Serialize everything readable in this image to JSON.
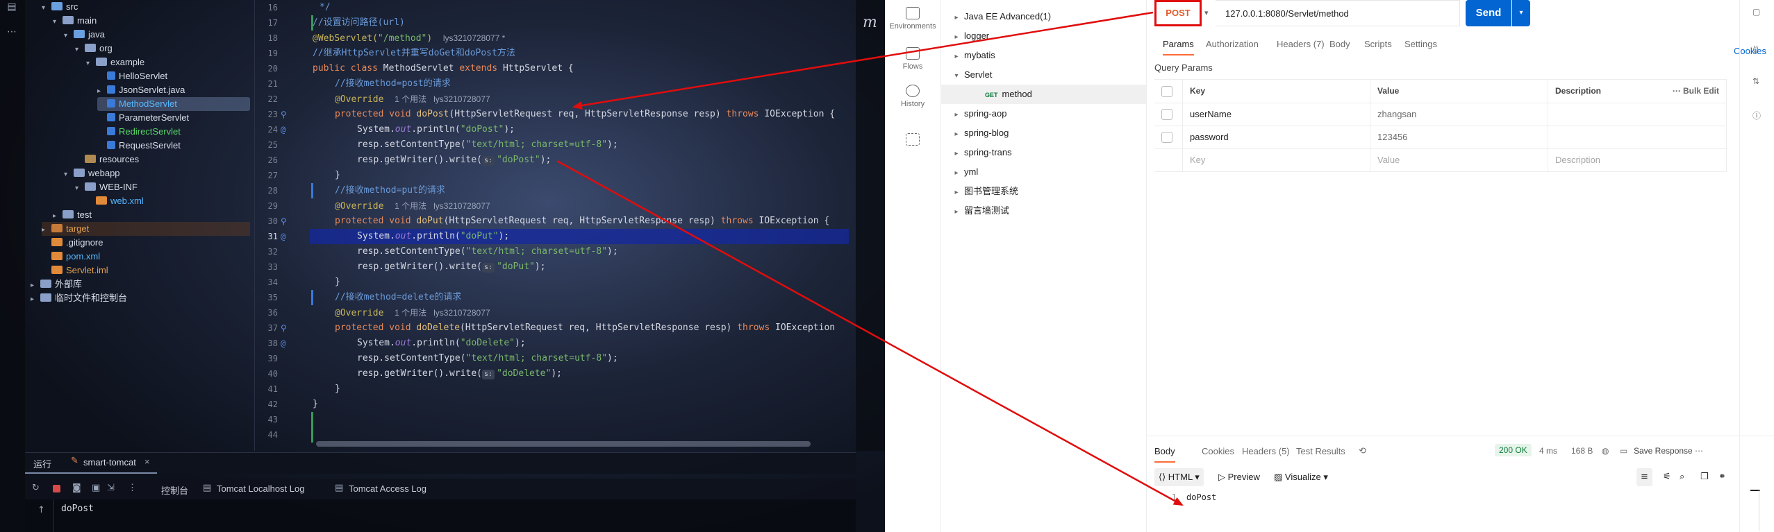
{
  "ide": {
    "tree": [
      {
        "label": "src",
        "indent": 1,
        "arrow": "v",
        "icon": "folder src"
      },
      {
        "label": "main",
        "indent": 2,
        "arrow": "v",
        "icon": "folder"
      },
      {
        "label": "java",
        "indent": 3,
        "arrow": "v",
        "icon": "folder src"
      },
      {
        "label": "org",
        "indent": 4,
        "arrow": "v",
        "icon": "folder"
      },
      {
        "label": "example",
        "indent": 5,
        "arrow": "v",
        "icon": "folder"
      },
      {
        "label": "HelloServlet",
        "indent": 6,
        "arrow": "",
        "icon": "cls"
      },
      {
        "label": "JsonServlet.java",
        "indent": 6,
        "arrow": ">",
        "icon": "cls"
      },
      {
        "label": "MethodServlet",
        "indent": 6,
        "arrow": "",
        "icon": "cls",
        "selected": true,
        "color": "#58b8ff"
      },
      {
        "label": "ParameterServlet",
        "indent": 6,
        "arrow": "",
        "icon": "cls"
      },
      {
        "label": "RedirectServlet",
        "indent": 6,
        "arrow": "",
        "icon": "cls",
        "color": "#5ad86a"
      },
      {
        "label": "RequestServlet",
        "indent": 6,
        "arrow": "",
        "icon": "cls"
      },
      {
        "label": "resources",
        "indent": 4,
        "arrow": "",
        "icon": "folder res"
      },
      {
        "label": "webapp",
        "indent": 3,
        "arrow": "v",
        "icon": "folder"
      },
      {
        "label": "WEB-INF",
        "indent": 4,
        "arrow": "v",
        "icon": "folder"
      },
      {
        "label": "web.xml",
        "indent": 5,
        "arrow": "",
        "icon": "xml",
        "color": "#58b8ff"
      },
      {
        "label": "test",
        "indent": 2,
        "arrow": ">",
        "icon": "folder"
      },
      {
        "label": "target",
        "indent": 1,
        "arrow": ">",
        "icon": "folder target",
        "target": true,
        "color": "#e0a050"
      },
      {
        "label": ".gitignore",
        "indent": 1,
        "arrow": "",
        "icon": "xml"
      },
      {
        "label": "pom.xml",
        "indent": 1,
        "arrow": "",
        "icon": "xml",
        "color": "#58b8ff"
      },
      {
        "label": "Servlet.iml",
        "indent": 1,
        "arrow": "",
        "icon": "xml",
        "color": "#e0a050"
      },
      {
        "label": "外部库",
        "indent": 0,
        "arrow": ">",
        "icon": "folder"
      },
      {
        "label": "临时文件和控制台",
        "indent": 0,
        "arrow": ">",
        "icon": "folder"
      }
    ],
    "line_numbers": [
      "16",
      "17",
      "18",
      "19",
      "20",
      "21",
      "22",
      "23",
      "24",
      "25",
      "26",
      "27",
      "28",
      "29",
      "30",
      "31",
      "32",
      "33",
      "34",
      "35",
      "36",
      "37",
      "38",
      "39",
      "40",
      "41",
      "42",
      "43",
      "44"
    ],
    "code": {
      "l16": "*/",
      "l17": "//设置访问路径(url)",
      "l18a": "@WebServlet(",
      "l18b": "\"/method\"",
      "l18c": ")",
      "l18hint": "lys3210728077 *",
      "l19": "//继承HttpServlet并重写doGet和doPost方法",
      "l20a": "public class ",
      "l20b": "MethodServlet ",
      "l20c": "extends ",
      "l20d": "HttpServlet {",
      "l21": "//接收method=post的请求",
      "l22a": "@Override",
      "l22hint": "1 个用法   lys3210728077",
      "l23a": "protected void ",
      "l23b": "doPost",
      "l23c": "(HttpServletRequest req, HttpServletResponse resp) ",
      "l23d": "throws ",
      "l23e": "IOException {",
      "l24a": "System.",
      "l24b": "out",
      "l24c": ".println(",
      "l24d": "\"doPost\"",
      "l24e": ");",
      "l25a": "resp.setContentType(",
      "l25b": "\"text/html; charset=utf-8\"",
      "l25c": ");",
      "l26a": "resp.getWriter().write(",
      "l26pill": "s:",
      "l26b": "\"doPost\"",
      "l26c": ");",
      "l27": "}",
      "l28": "//接收method=put的请求",
      "l29a": "@Override",
      "l29hint": "1 个用法   lys3210728077",
      "l30a": "protected void ",
      "l30b": "doPut",
      "l30c": "(HttpServletRequest req, HttpServletResponse resp) ",
      "l30d": "throws ",
      "l30e": "IOException {",
      "l31a": "System.",
      "l31b": "out",
      "l31c": ".println(",
      "l31d": "\"doPut\"",
      "l31e": ");",
      "l32a": "resp.setContentType(",
      "l32b": "\"text/html; charset=utf-8\"",
      "l32c": ");",
      "l33a": "resp.getWriter().write(",
      "l33pill": "s:",
      "l33b": "\"doPut\"",
      "l33c": ");",
      "l34": "}",
      "l35": "//接收method=delete的请求",
      "l36a": "@Override",
      "l36hint": "1 个用法   lys3210728077",
      "l37a": "protected void ",
      "l37b": "doDelete",
      "l37c": "(HttpServletRequest req, HttpServletResponse resp) ",
      "l37d": "throws ",
      "l37e": "IOException",
      "l38a": "System.",
      "l38b": "out",
      "l38c": ".println(",
      "l38d": "\"doDelete\"",
      "l38e": ");",
      "l39a": "resp.setContentType(",
      "l39b": "\"text/html; charset=utf-8\"",
      "l39c": ");",
      "l40a": "resp.getWriter().write(",
      "l40pill": "s:",
      "l40b": "\"doDelete\"",
      "l40c": ");",
      "l41": "}",
      "l42": "}"
    },
    "run": {
      "title": "运行",
      "config": "smart-tomcat",
      "close": "×",
      "tabs": [
        "控制台",
        "Tomcat Localhost Log",
        "Tomcat Access Log"
      ],
      "output": "doPost",
      "up_arrow": "↑"
    },
    "logo": "m"
  },
  "postman": {
    "rail": [
      "Environments",
      "Flows",
      "History"
    ],
    "tree": [
      {
        "label": "Java EE Advanced(1)",
        "caret": ">",
        "indent": 0
      },
      {
        "label": "logger",
        "caret": ">",
        "indent": 0
      },
      {
        "label": "mybatis",
        "caret": ">",
        "indent": 0
      },
      {
        "label": "Servlet",
        "caret": "v",
        "indent": 0
      },
      {
        "label": "method",
        "caret": "",
        "indent": 1,
        "method": "GET",
        "selected": true
      },
      {
        "label": "spring-aop",
        "caret": ">",
        "indent": 0
      },
      {
        "label": "spring-blog",
        "caret": ">",
        "indent": 0
      },
      {
        "label": "spring-trans",
        "caret": ">",
        "indent": 0
      },
      {
        "label": "yml",
        "caret": ">",
        "indent": 0
      },
      {
        "label": "图书管理系统",
        "caret": ">",
        "indent": 0
      },
      {
        "label": "留言墙测试",
        "caret": ">",
        "indent": 0
      }
    ],
    "request": {
      "method": "POST",
      "url": "127.0.0.1:8080/Servlet/method",
      "send": "Send",
      "tabs": [
        "Params",
        "Authorization",
        "Headers (7)",
        "Body",
        "Scripts",
        "Settings"
      ],
      "cookies": "Cookies",
      "query_title": "Query Params",
      "columns": [
        "Key",
        "Value",
        "Description"
      ],
      "bulk_edit": "Bulk Edit",
      "params": [
        {
          "key": "userName",
          "value": "zhangsan",
          "description": ""
        },
        {
          "key": "password",
          "value": "123456",
          "description": ""
        }
      ],
      "placeholder": {
        "key": "Key",
        "value": "Value",
        "description": "Description"
      }
    },
    "response": {
      "tabs": [
        "Body",
        "Cookies",
        "Headers (5)",
        "Test Results"
      ],
      "status": "200 OK",
      "time": "4 ms",
      "size": "168 B",
      "save": "Save Response",
      "format": "HTML",
      "preview": "Preview",
      "visualize": "Visualize",
      "line_no": "1",
      "body": "doPost"
    }
  },
  "colors": {
    "annotation_red": "#e00d0d",
    "postman_blue": "#0265d2",
    "postman_orange": "#ff6c37",
    "current_line": "#14289f"
  }
}
